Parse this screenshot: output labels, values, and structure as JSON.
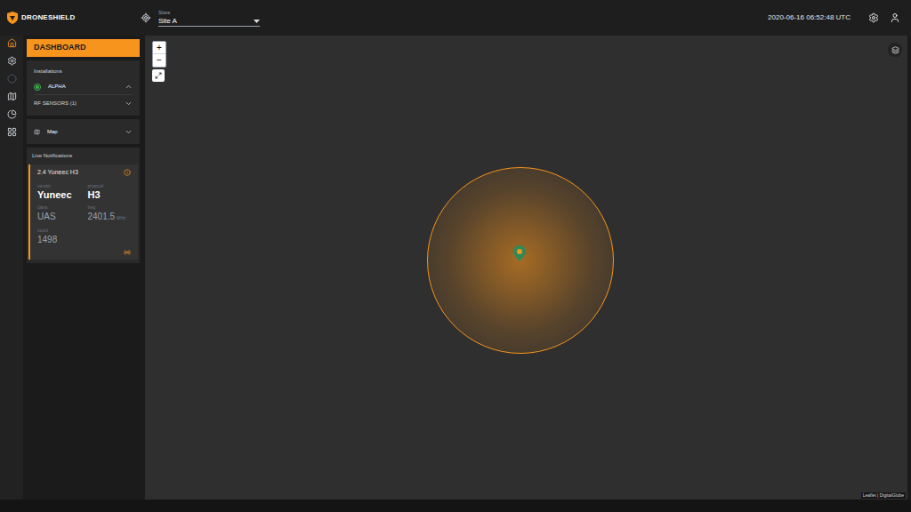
{
  "header": {
    "logo": "DRONESHIELD",
    "site_label": "Sites",
    "site": "Site A",
    "timestamp": "2020-06-16 06:52:48 UTC"
  },
  "nav_rail": [
    {
      "selected": true,
      "disabled": false
    },
    {
      "selected": false,
      "disabled": false
    },
    {
      "selected": false,
      "disabled": true
    },
    {
      "selected": false,
      "disabled": false
    },
    {
      "selected": false,
      "disabled": false
    },
    {
      "selected": false,
      "disabled": false
    }
  ],
  "sidebar": {
    "title": "DASHBOARD",
    "section_label": "Installations",
    "installation": {
      "name": "ALPHA",
      "expanded": true
    },
    "groups": [
      {
        "label": "RF SENSORS (1)",
        "expanded": false
      }
    ],
    "map_panel": {
      "label": "Map",
      "expanded": false
    },
    "notifications": {
      "label": "Live Notifications",
      "items": [
        {
          "title": "2.4 Yuneec H3",
          "fields": [
            {
              "label": "vendor",
              "value": "Yuneec",
              "unit": "",
              "emphasis": true
            },
            {
              "label": "protocol",
              "value": "H3",
              "unit": "",
              "emphasis": true
            },
            {
              "label": "class",
              "value": "UAS",
              "unit": "",
              "emphasis": false
            },
            {
              "label": "freq",
              "value": "2401.5",
              "unit": "MHz",
              "emphasis": false
            },
            {
              "label": "count",
              "value": "1498",
              "unit": "",
              "emphasis": false
            }
          ]
        }
      ]
    }
  },
  "map": {
    "zoom_in": "+",
    "zoom_out": "−",
    "attribution": "Leaflet | DigitalGlobe"
  }
}
